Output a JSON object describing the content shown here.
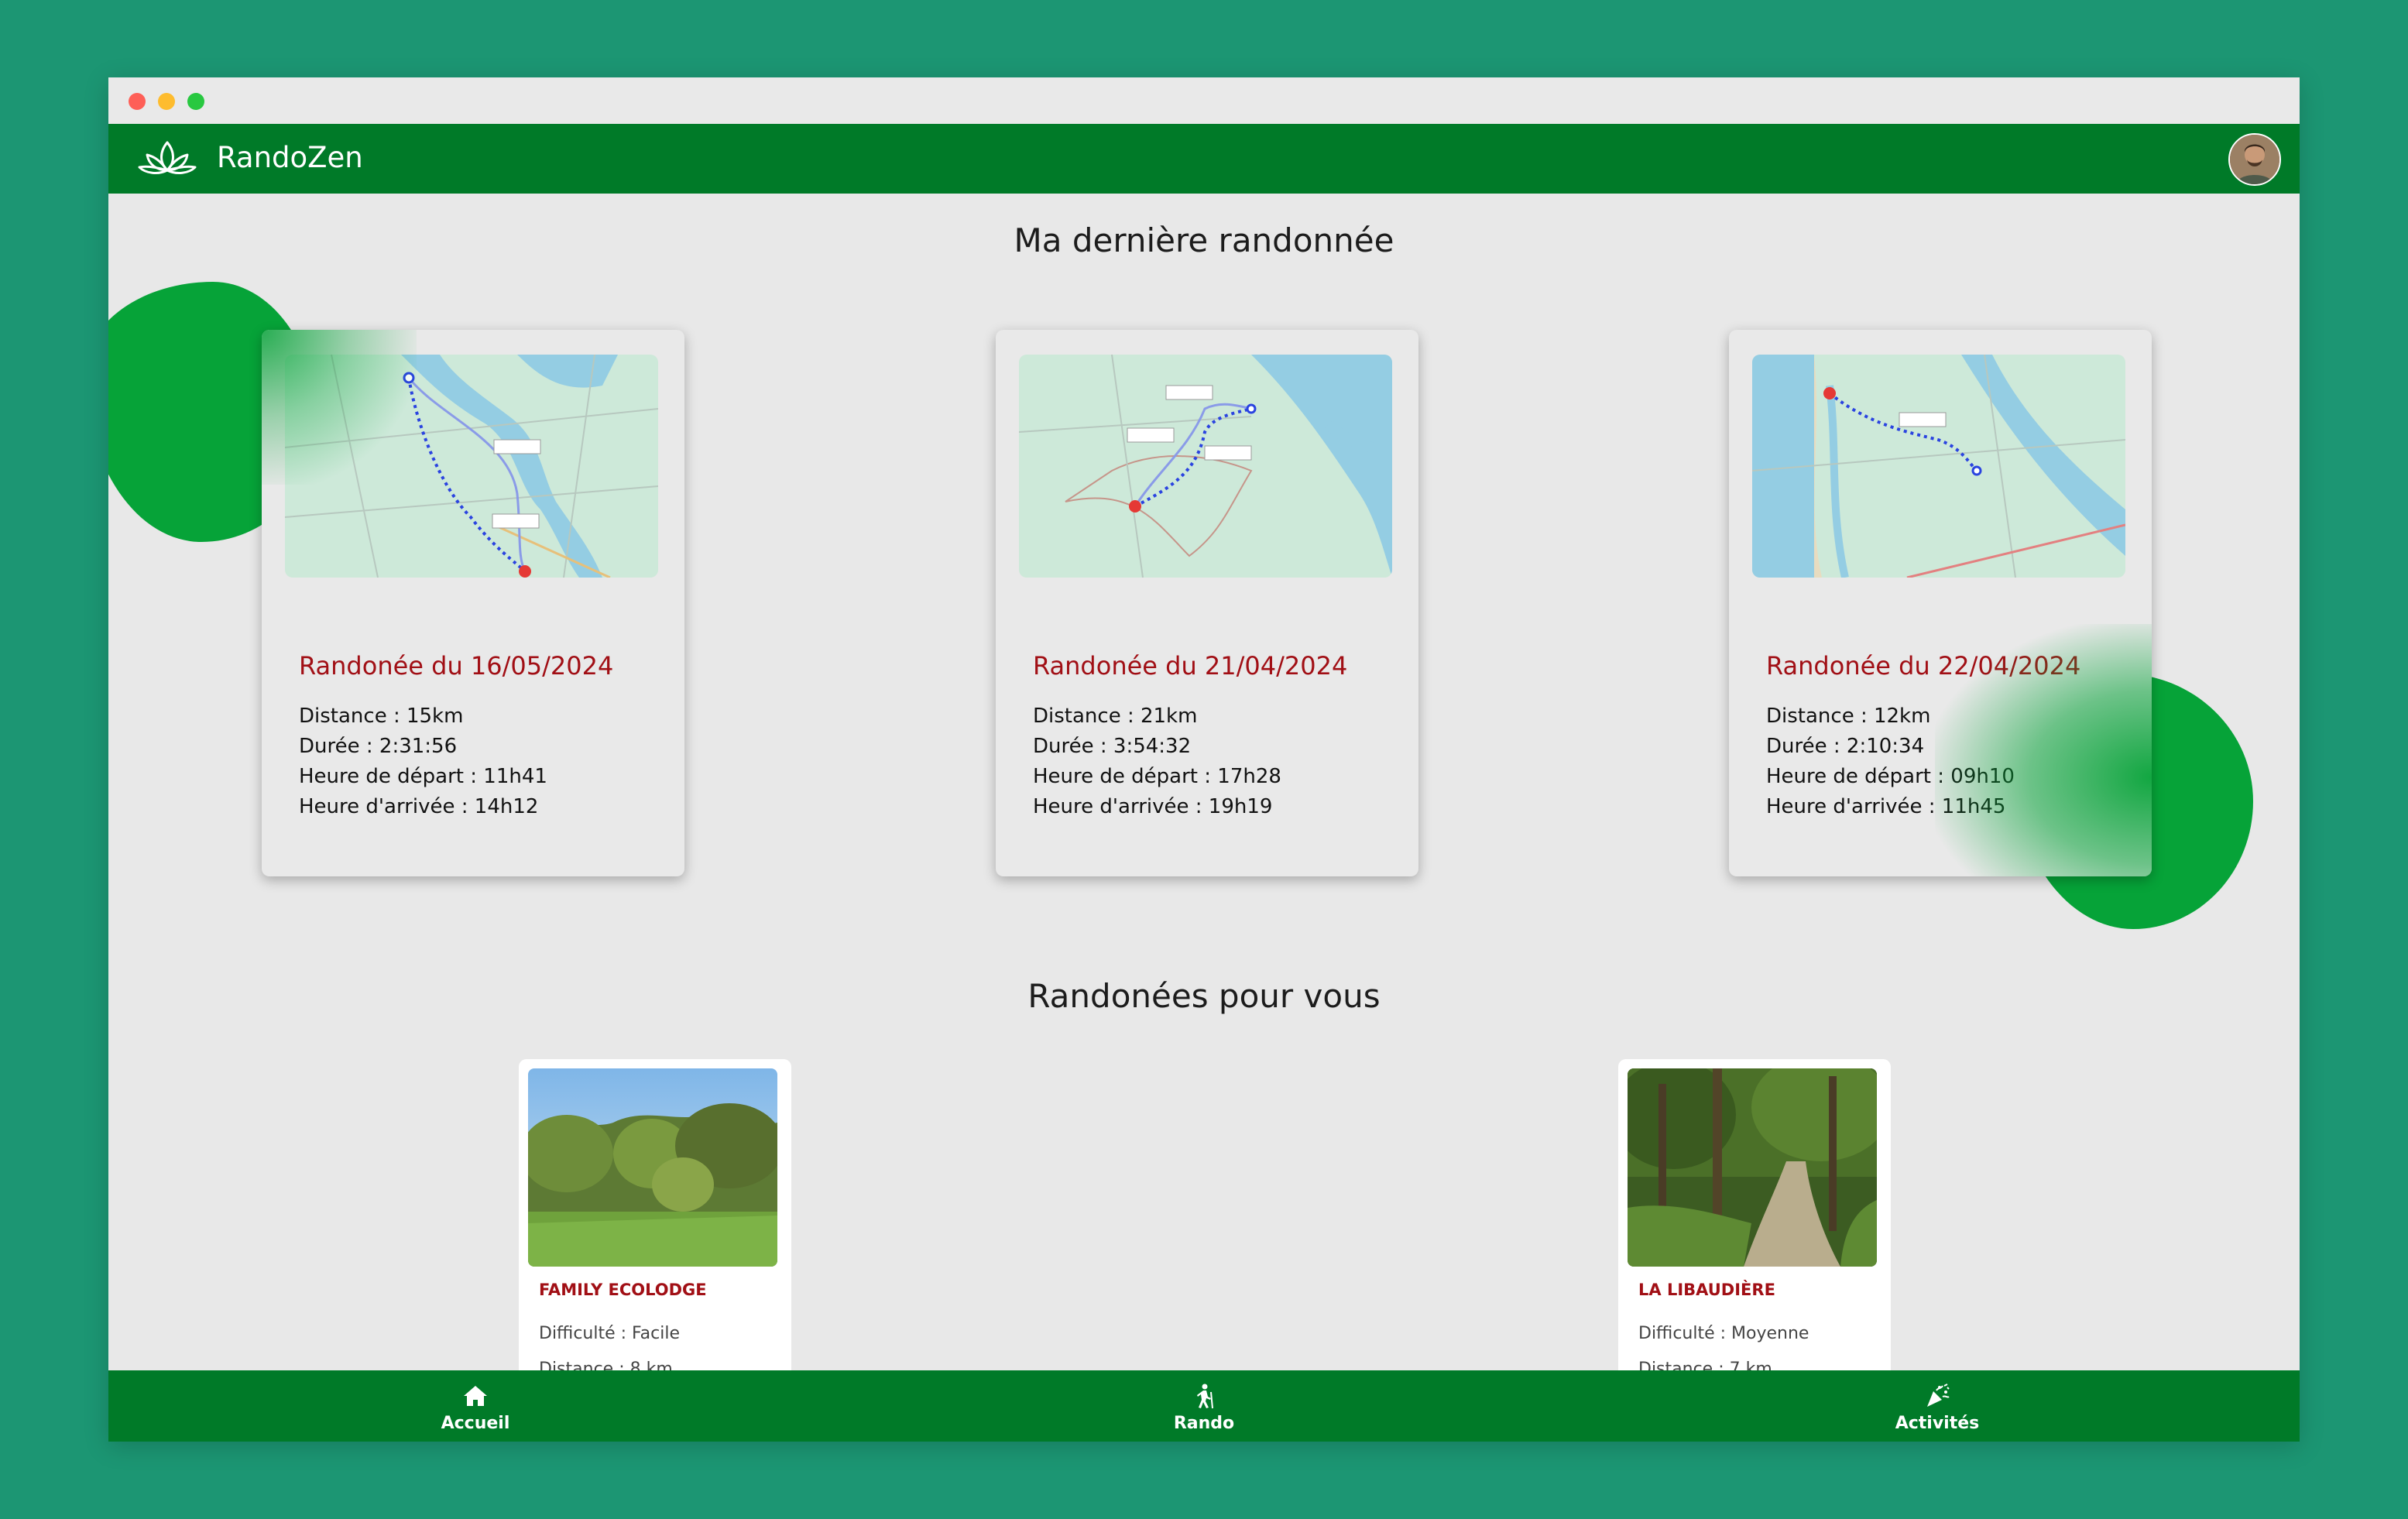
{
  "app": {
    "name": "RandoZen"
  },
  "sections": {
    "last_hike_title": "Ma dernière randonnée",
    "recommended_title": "Randonées pour vous"
  },
  "hikes": [
    {
      "title": "Randonée du 16/05/2024",
      "distance": "Distance : 15km",
      "duration": "Durée : 2:31:56",
      "departure": "Heure de départ : 11h41",
      "arrival": "Heure d'arrivée : 14h12"
    },
    {
      "title": "Randonée du 21/04/2024",
      "distance": "Distance : 21km",
      "duration": "Durée : 3:54:32",
      "departure": "Heure de départ : 17h28",
      "arrival": "Heure d'arrivée : 19h19"
    },
    {
      "title": "Randonée du 22/04/2024",
      "distance": "Distance : 12km",
      "duration": "Durée : 2:10:34",
      "departure": "Heure de départ : 09h10",
      "arrival": "Heure d'arrivée : 11h45"
    }
  ],
  "recommendations": [
    {
      "name": "FAMILY ECOLODGE",
      "difficulty": "Difficulté : Facile",
      "distance": "Distance : 8 km"
    },
    {
      "name": "LA LIBAUDIÈRE",
      "difficulty": "Difficulté : Moyenne",
      "distance": "Distance : 7 km"
    }
  ],
  "nav": [
    {
      "label": "Accueil",
      "icon": "home-icon"
    },
    {
      "label": "Rando",
      "icon": "hiker-icon"
    },
    {
      "label": "Activités",
      "icon": "party-icon"
    }
  ],
  "colors": {
    "primary": "#007a28",
    "accent": "#06a338",
    "title_red": "#a10f15",
    "background": "#1c9673"
  }
}
